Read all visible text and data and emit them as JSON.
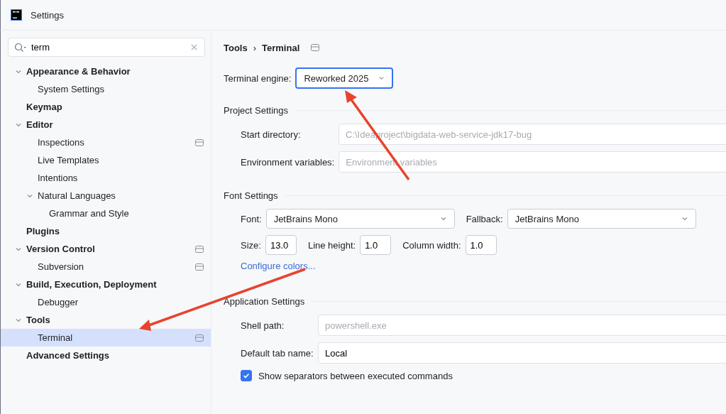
{
  "window": {
    "title": "Settings"
  },
  "search": {
    "value": "term"
  },
  "tree": [
    {
      "label": "Appearance & Behavior",
      "bold": true,
      "expanded": true,
      "selected": false,
      "project_icon": false,
      "children": [
        {
          "label": "System Settings",
          "bold": false,
          "selected": false,
          "project_icon": false
        }
      ]
    },
    {
      "label": "Keymap",
      "bold": true,
      "selected": false,
      "project_icon": false
    },
    {
      "label": "Editor",
      "bold": true,
      "expanded": true,
      "selected": false,
      "project_icon": false,
      "children": [
        {
          "label": "Inspections",
          "bold": false,
          "selected": false,
          "project_icon": true
        },
        {
          "label": "Live Templates",
          "bold": false,
          "selected": false,
          "project_icon": false
        },
        {
          "label": "Intentions",
          "bold": false,
          "selected": false,
          "project_icon": false
        },
        {
          "label": "Natural Languages",
          "bold": false,
          "expanded": true,
          "selected": false,
          "project_icon": false,
          "children": [
            {
              "label": "Grammar and Style",
              "bold": false,
              "selected": false,
              "project_icon": false
            }
          ]
        }
      ]
    },
    {
      "label": "Plugins",
      "bold": true,
      "selected": false,
      "project_icon": false
    },
    {
      "label": "Version Control",
      "bold": true,
      "expanded": true,
      "selected": false,
      "project_icon": true,
      "children": [
        {
          "label": "Subversion",
          "bold": false,
          "selected": false,
          "project_icon": true
        }
      ]
    },
    {
      "label": "Build, Execution, Deployment",
      "bold": true,
      "expanded": true,
      "selected": false,
      "project_icon": false,
      "children": [
        {
          "label": "Debugger",
          "bold": false,
          "selected": false,
          "project_icon": false
        }
      ]
    },
    {
      "label": "Tools",
      "bold": true,
      "expanded": true,
      "selected": false,
      "project_icon": false,
      "children": [
        {
          "label": "Terminal",
          "bold": false,
          "selected": true,
          "project_icon": true
        }
      ]
    },
    {
      "label": "Advanced Settings",
      "bold": true,
      "selected": false,
      "project_icon": false
    }
  ],
  "breadcrumb": [
    "Tools",
    "Terminal"
  ],
  "breadcrumb_separator": "›",
  "engine": {
    "label": "Terminal engine:",
    "value": "Reworked 2025"
  },
  "project_settings": {
    "title": "Project Settings",
    "fields": [
      {
        "label": "Start directory:",
        "placeholder": "C:\\Ideaproject\\bigdata-web-service-jdk17-bug"
      },
      {
        "label": "Environment variables:",
        "placeholder": "Environment variables"
      }
    ]
  },
  "font_settings": {
    "title": "Font Settings",
    "font_label": "Font:",
    "font": "JetBrains Mono",
    "fallback_label": "Fallback:",
    "fallback": "JetBrains Mono",
    "numbers": [
      {
        "label": "Size:",
        "value": "13.0"
      },
      {
        "label": "Line height:",
        "value": "1.0"
      },
      {
        "label": "Column width:",
        "value": "1.0"
      }
    ],
    "link": "Configure colors..."
  },
  "application_settings": {
    "title": "Application Settings",
    "shell": {
      "label": "Shell path:",
      "placeholder": "powershell.exe"
    },
    "tab_name": {
      "label": "Default tab name:",
      "value": "Local"
    },
    "checkboxes": [
      {
        "label": "Show separators between executed commands",
        "checked": true
      }
    ]
  }
}
